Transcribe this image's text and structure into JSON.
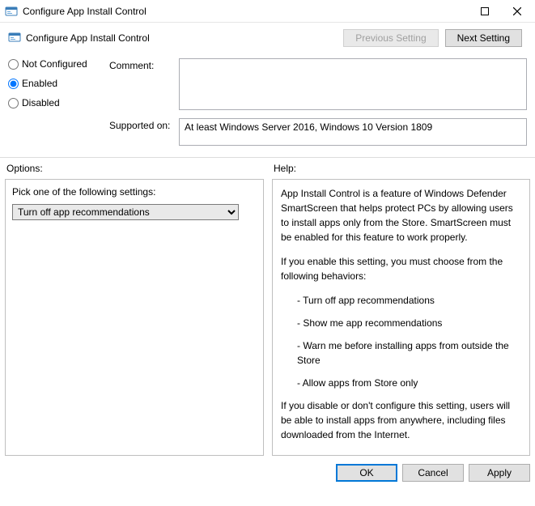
{
  "window": {
    "title": "Configure App Install Control",
    "controls": {
      "min": "–",
      "max": "☐",
      "close": "✕"
    }
  },
  "header": {
    "title": "Configure App Install Control",
    "prev_label": "Previous Setting",
    "next_label": "Next Setting"
  },
  "state": {
    "not_configured_label": "Not Configured",
    "enabled_label": "Enabled",
    "disabled_label": "Disabled",
    "selected": "enabled"
  },
  "comment": {
    "label": "Comment:",
    "value": ""
  },
  "supported": {
    "label": "Supported on:",
    "value": "At least Windows Server 2016, Windows 10 Version 1809"
  },
  "options": {
    "section_label": "Options:",
    "prompt": "Pick one of the following settings:",
    "selected_value": "Turn off app recommendations"
  },
  "help": {
    "section_label": "Help:",
    "p1": "App Install Control is a feature of Windows Defender SmartScreen that helps protect PCs by allowing users to install apps only from the Store.  SmartScreen must be enabled for this feature to work properly.",
    "p2": "If you enable this setting, you must choose from the following behaviors:",
    "b1": "- Turn off app recommendations",
    "b2": "- Show me app recommendations",
    "b3": "- Warn me before installing apps from outside the Store",
    "b4": "- Allow apps from Store only",
    "p3": "If you disable or don't configure this setting, users will be able to install apps from anywhere, including files downloaded from the Internet."
  },
  "footer": {
    "ok": "OK",
    "cancel": "Cancel",
    "apply": "Apply"
  }
}
